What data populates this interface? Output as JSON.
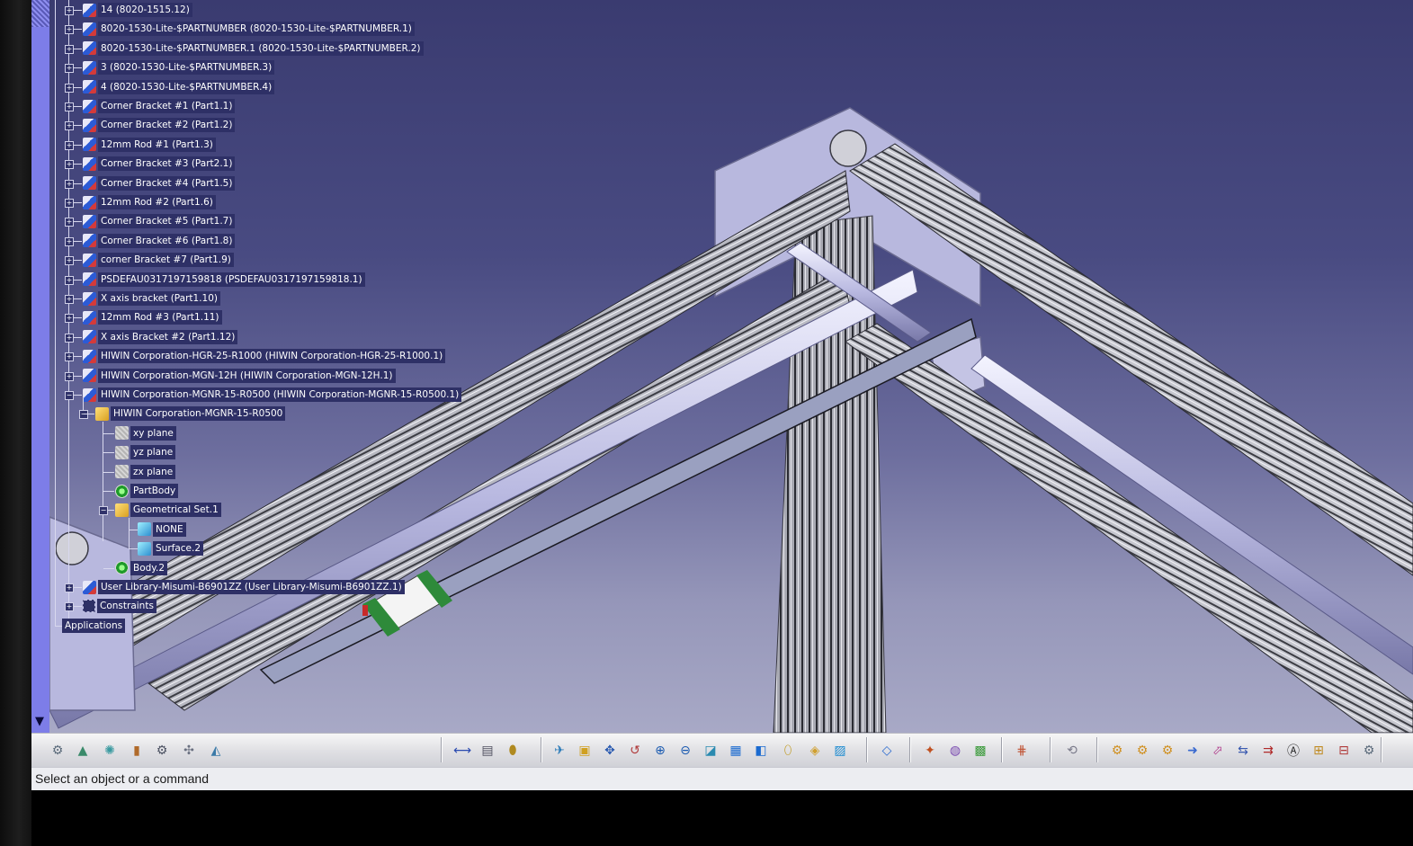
{
  "tree": {
    "items": [
      {
        "label": "14 (8020-1515.12)",
        "icon": "product-icon"
      },
      {
        "label": "8020-1530-Lite-$PARTNUMBER (8020-1530-Lite-$PARTNUMBER.1)",
        "icon": "product-icon"
      },
      {
        "label": "8020-1530-Lite-$PARTNUMBER.1 (8020-1530-Lite-$PARTNUMBER.2)",
        "icon": "product-icon"
      },
      {
        "label": "3 (8020-1530-Lite-$PARTNUMBER.3)",
        "icon": "product-icon"
      },
      {
        "label": "4 (8020-1530-Lite-$PARTNUMBER.4)",
        "icon": "product-icon"
      },
      {
        "label": "Corner Bracket #1 (Part1.1)",
        "icon": "part-icon"
      },
      {
        "label": "Corner Bracket #2 (Part1.2)",
        "icon": "part-icon"
      },
      {
        "label": "12mm Rod #1 (Part1.3)",
        "icon": "part-icon"
      },
      {
        "label": "Corner Bracket #3 (Part2.1)",
        "icon": "part-icon"
      },
      {
        "label": "Corner Bracket #4 (Part1.5)",
        "icon": "part-icon"
      },
      {
        "label": "12mm Rod #2 (Part1.6)",
        "icon": "part-icon"
      },
      {
        "label": "Corner Bracket #5 (Part1.7)",
        "icon": "part-icon"
      },
      {
        "label": "Corner Bracket #6 (Part1.8)",
        "icon": "part-icon"
      },
      {
        "label": "corner Bracket #7 (Part1.9)",
        "icon": "part-icon"
      },
      {
        "label": "PSDEFAU0317197159818 (PSDEFAU0317197159818.1)",
        "icon": "part-icon"
      },
      {
        "label": "X axis bracket (Part1.10)",
        "icon": "part-icon"
      },
      {
        "label": "12mm Rod #3 (Part1.11)",
        "icon": "part-icon"
      },
      {
        "label": "X axis Bracket #2 (Part1.12)",
        "icon": "part-icon"
      },
      {
        "label": "HIWIN Corporation-HGR-25-R1000 (HIWIN Corporation-HGR-25-R1000.1)",
        "icon": "part-icon"
      },
      {
        "label": "HIWIN Corporation-MGN-12H (HIWIN Corporation-MGN-12H.1)",
        "icon": "part-icon"
      },
      {
        "label": "HIWIN Corporation-MGNR-15-R0500 (HIWIN Corporation-MGNR-15-R0500.1)",
        "icon": "part-icon"
      }
    ],
    "sub": {
      "part": "HIWIN Corporation-MGNR-15-R0500",
      "xy": "xy plane",
      "yz": "yz plane",
      "zx": "zx plane",
      "partbody": "PartBody",
      "geoset": "Geometrical Set.1",
      "none": "NONE",
      "surface": "Surface.2",
      "body2": "Body.2"
    },
    "user_library": "User Library-Misumi-B6901ZZ (User Library-Misumi-B6901ZZ.1)",
    "constraints": "Constraints",
    "applications": "Applications"
  },
  "toolbar": {
    "buttons": [
      {
        "icon": "gear-cluster-icon",
        "color": "#5a6a7a"
      },
      {
        "icon": "assembly-design-icon",
        "color": "#3a8a6a"
      },
      {
        "icon": "rendering-icon",
        "color": "#3a9aa0"
      },
      {
        "icon": "catalog-icon",
        "color": "#b06a2a"
      },
      {
        "icon": "settings-gear-icon",
        "color": "#4a5060"
      },
      {
        "icon": "kinematics-icon",
        "color": "#6a7080"
      },
      {
        "icon": "drafting-icon",
        "color": "#3a7aa8"
      },
      {
        "icon": "measure-icon",
        "color": "#2a4ab0"
      },
      {
        "icon": "print-icon",
        "color": "#505060"
      },
      {
        "icon": "macro-bottle-icon",
        "color": "#b08a20"
      },
      {
        "icon": "fly-mode-icon",
        "color": "#2a7ab8"
      },
      {
        "icon": "fit-all-icon",
        "color": "#d0a020"
      },
      {
        "icon": "pan-icon",
        "color": "#2a5ab0"
      },
      {
        "icon": "rotate-icon",
        "color": "#b03a3a"
      },
      {
        "icon": "zoom-in-icon",
        "color": "#1a5ab0"
      },
      {
        "icon": "zoom-out-icon",
        "color": "#1a5ab0"
      },
      {
        "icon": "normal-view-icon",
        "color": "#2a8ab0"
      },
      {
        "icon": "multi-view-icon",
        "color": "#1a6ad0"
      },
      {
        "icon": "iso-view-icon",
        "color": "#1a6ad0"
      },
      {
        "icon": "shading-icon",
        "color": "#c09a20"
      },
      {
        "icon": "hide-show-icon",
        "color": "#d0a030"
      },
      {
        "icon": "swap-visible-icon",
        "color": "#1a8ad0"
      },
      {
        "icon": "plane-icon",
        "color": "#2a6ad0"
      },
      {
        "icon": "update-icon",
        "color": "#c05020"
      },
      {
        "icon": "material-icon",
        "color": "#7a4ab0"
      },
      {
        "icon": "color-palette-icon",
        "color": "#3a9a3a"
      },
      {
        "icon": "grid-icon",
        "color": "#c05030"
      },
      {
        "icon": "spiral-icon",
        "color": "#7a7a8a"
      },
      {
        "icon": "insert-part-icon",
        "color": "#d09020"
      },
      {
        "icon": "existing-component-icon",
        "color": "#d09020"
      },
      {
        "icon": "replace-component-icon",
        "color": "#d09020"
      },
      {
        "icon": "manipulate-icon",
        "color": "#3a6ad0"
      },
      {
        "icon": "snap-icon",
        "color": "#b03a8a"
      },
      {
        "icon": "explode-icon",
        "color": "#3a5ab0"
      },
      {
        "icon": "stop-manipulate-icon",
        "color": "#b02a2a"
      },
      {
        "icon": "annotation-icon",
        "color": "#2a2a2a"
      },
      {
        "icon": "bill-of-material-icon",
        "color": "#c08a20"
      },
      {
        "icon": "scene-icon",
        "color": "#b03a3a"
      },
      {
        "icon": "analysis-icon",
        "color": "#5a6a7a"
      }
    ]
  },
  "status": {
    "text": "Select an object or a command"
  }
}
